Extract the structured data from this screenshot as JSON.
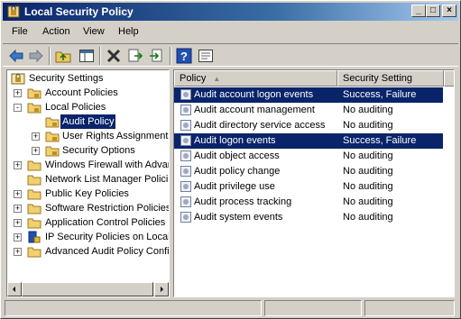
{
  "window": {
    "title": "Local Security Policy"
  },
  "menu": [
    "File",
    "Action",
    "View",
    "Help"
  ],
  "toolbar": {
    "icons": [
      "back-arrow-icon",
      "forward-arrow-icon",
      "up-folder-icon",
      "show-hide-tree-icon",
      "delete-icon",
      "export-list-icon",
      "import-icon",
      "help-icon",
      "properties-icon"
    ]
  },
  "tree": {
    "root": "Security Settings",
    "items": [
      {
        "label": "Account Policies",
        "expander": "+"
      },
      {
        "label": "Local Policies",
        "expander": "-"
      },
      {
        "label": "Audit Policy",
        "selected": true
      },
      {
        "label": "User Rights Assignment",
        "expander": "+"
      },
      {
        "label": "Security Options",
        "expander": "+"
      },
      {
        "label": "Windows Firewall with Advanced Security",
        "expander": "+"
      },
      {
        "label": "Network List Manager Policies"
      },
      {
        "label": "Public Key Policies",
        "expander": "+"
      },
      {
        "label": "Software Restriction Policies",
        "expander": "+"
      },
      {
        "label": "Application Control Policies",
        "expander": "+"
      },
      {
        "label": "IP Security Policies on Local Computer",
        "expander": "+"
      },
      {
        "label": "Advanced Audit Policy Configuration",
        "expander": "+"
      }
    ]
  },
  "list": {
    "columns": [
      "Policy",
      "Security Setting"
    ],
    "rows": [
      {
        "policy": "Audit account logon events",
        "setting": "Success, Failure",
        "selected": true
      },
      {
        "policy": "Audit account management",
        "setting": "No auditing"
      },
      {
        "policy": "Audit directory service access",
        "setting": "No auditing"
      },
      {
        "policy": "Audit logon events",
        "setting": "Success, Failure",
        "selected": true
      },
      {
        "policy": "Audit object access",
        "setting": "No auditing"
      },
      {
        "policy": "Audit policy change",
        "setting": "No auditing"
      },
      {
        "policy": "Audit privilege use",
        "setting": "No auditing"
      },
      {
        "policy": "Audit process tracking",
        "setting": "No auditing"
      },
      {
        "policy": "Audit system events",
        "setting": "No auditing"
      }
    ]
  }
}
